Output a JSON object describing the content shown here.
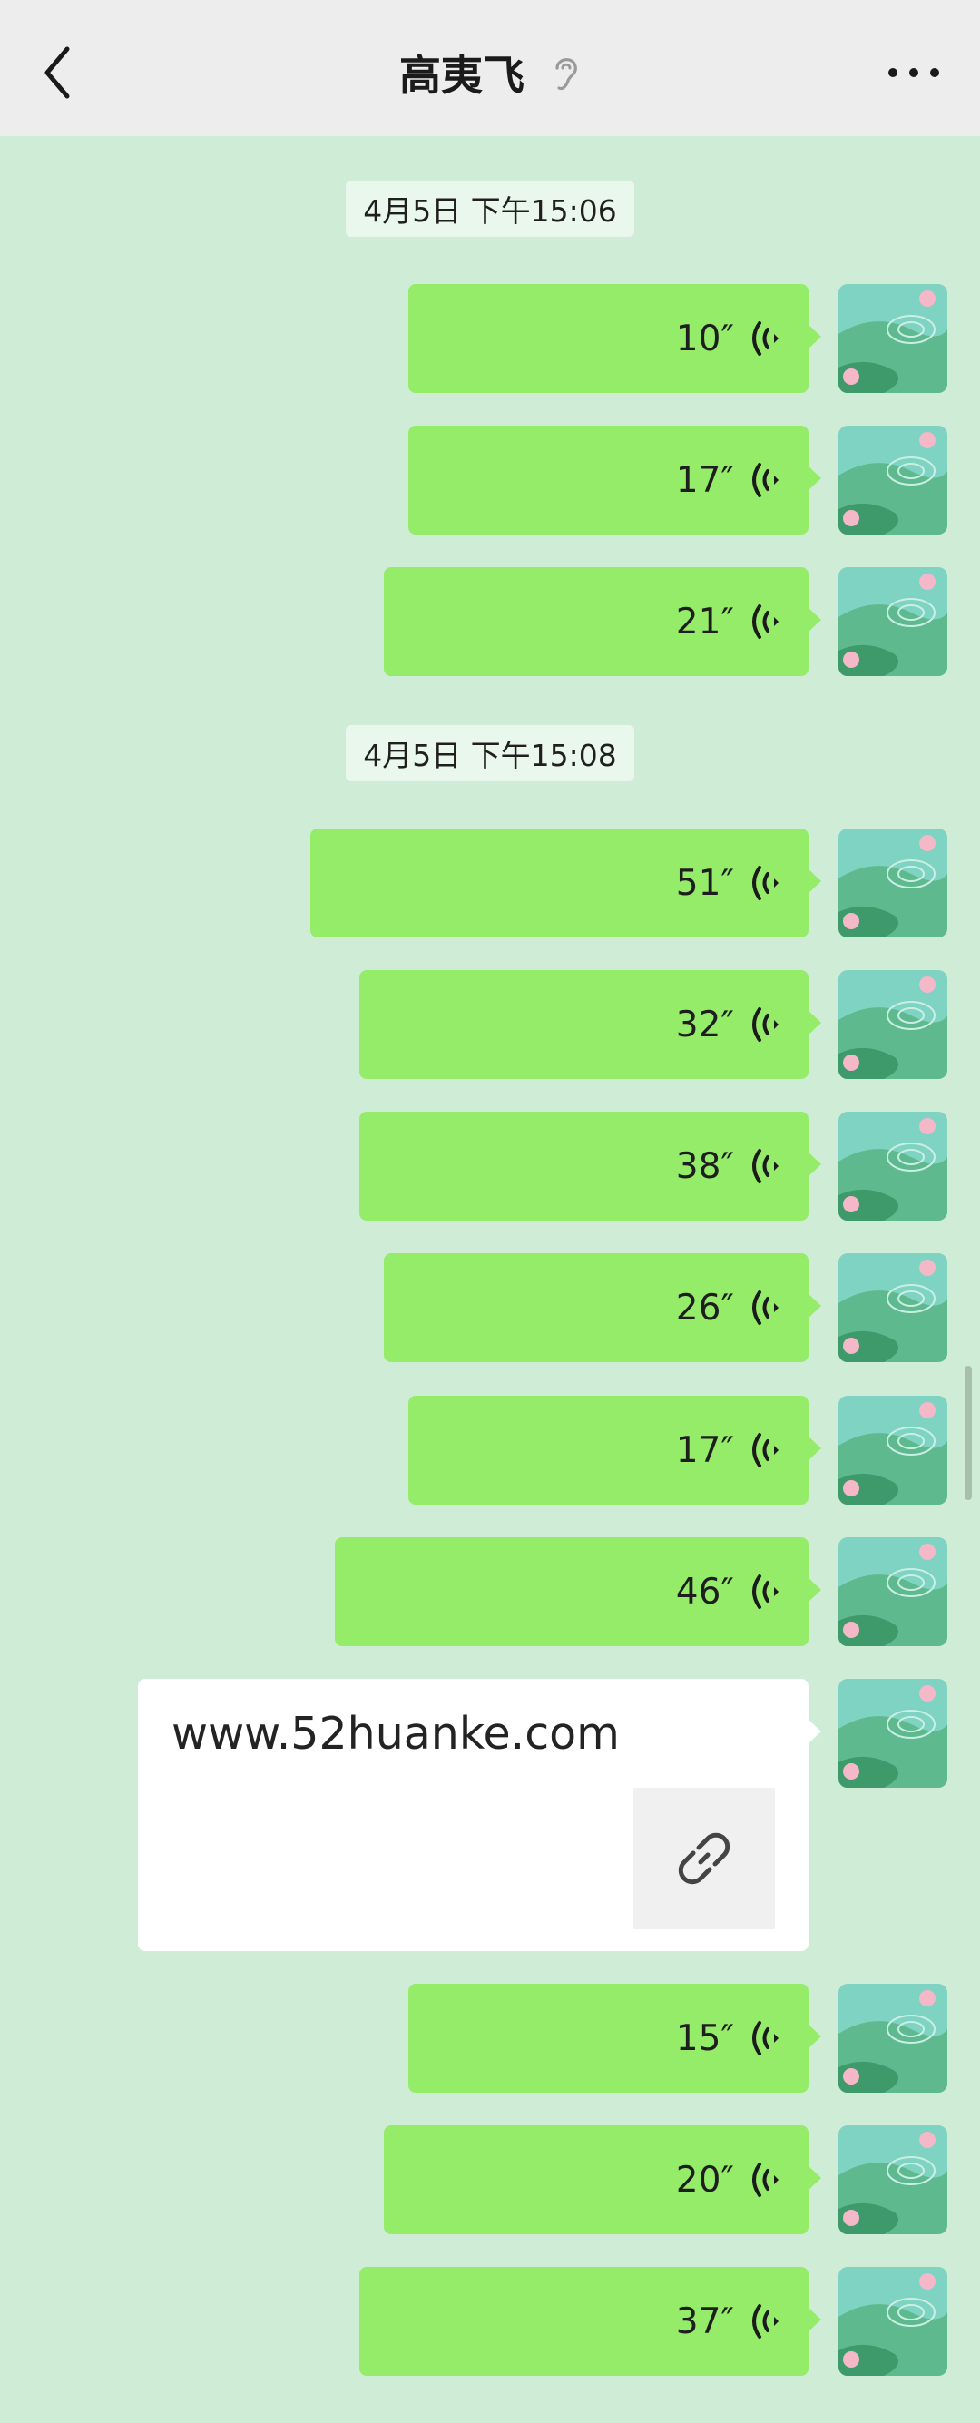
{
  "header": {
    "title": "高夷飞",
    "icons": [
      "back-arrow-icon",
      "ear-icon",
      "more-dots-icon"
    ]
  },
  "timestamps": [
    "4月5日 下午15:06",
    "4月5日 下午15:08"
  ],
  "messages_group1": [
    "10″",
    "17″",
    "21″"
  ],
  "messages_group2": [
    "51″",
    "32″",
    "38″",
    "26″",
    "17″",
    "46″"
  ],
  "link_card": {
    "text": "www.52huanke.com",
    "icon": "link-icon"
  },
  "messages_group3": [
    "15″",
    "20″",
    "37″"
  ],
  "colors": {
    "background": "#cfecd6",
    "header": "#ededed",
    "bubble": "#95ec69",
    "link_card": "#ffffff"
  }
}
